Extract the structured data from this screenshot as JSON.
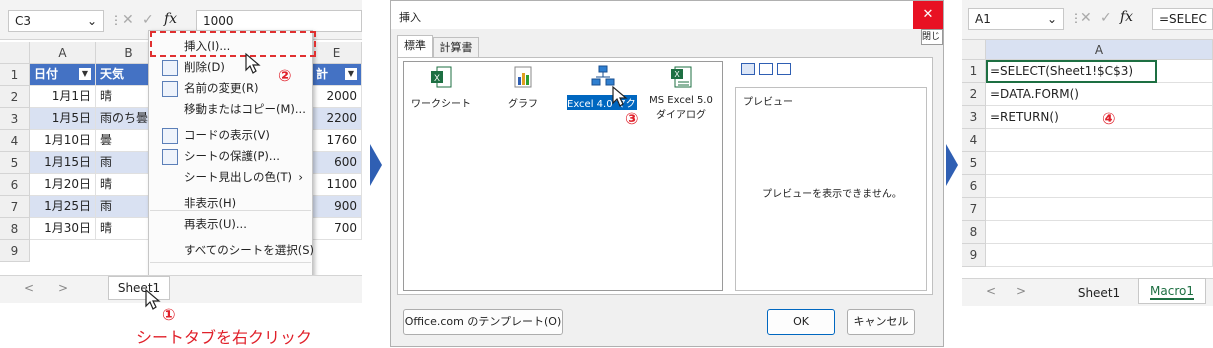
{
  "panel1": {
    "name_box": "C3",
    "formula_value": "1000",
    "columns": [
      "A",
      "B",
      "E"
    ],
    "rows": [
      "1",
      "2",
      "3",
      "4",
      "5",
      "6",
      "7",
      "8",
      "9"
    ],
    "table_header": {
      "date": "日付",
      "weather": "天気",
      "amount": "計"
    },
    "table_rows": [
      {
        "date": "1月1日",
        "weather": "晴",
        "amount": "2000"
      },
      {
        "date": "1月5日",
        "weather": "雨のち曇",
        "amount": "2200"
      },
      {
        "date": "1月10日",
        "weather": "曇",
        "amount": "1760"
      },
      {
        "date": "1月15日",
        "weather": "雨",
        "amount": "600"
      },
      {
        "date": "1月20日",
        "weather": "晴",
        "amount": "1100"
      },
      {
        "date": "1月25日",
        "weather": "雨",
        "amount": "900"
      },
      {
        "date": "1月30日",
        "weather": "晴",
        "amount": "700"
      }
    ],
    "context_menu": [
      {
        "label": "挿入(I)...",
        "icon": "none"
      },
      {
        "label": "削除(D)",
        "icon": "delete-sheet-icon"
      },
      {
        "label": "名前の変更(R)",
        "icon": "rename-icon"
      },
      {
        "label": "移動またはコピー(M)...",
        "icon": "none"
      },
      {
        "label": "コードの表示(V)",
        "icon": "view-code-icon"
      },
      {
        "label": "シートの保護(P)...",
        "icon": "protect-sheet-icon"
      },
      {
        "label": "シート見出しの色(T)",
        "icon": "none",
        "submenu": "›"
      },
      {
        "label": "非表示(H)",
        "icon": "none"
      },
      {
        "label": "再表示(U)...",
        "icon": "none"
      },
      {
        "label": "すべてのシートを選択(S)",
        "icon": "none"
      }
    ],
    "sheet_tab": "Sheet1",
    "step1": "①",
    "step2": "②",
    "caption": "シートタブを右クリック",
    "nav_left": "<",
    "nav_right": ">"
  },
  "panel2": {
    "title": "挿入",
    "close": "✕",
    "side_close": "閉じ",
    "tabs": [
      "標準",
      "計算書"
    ],
    "templates": [
      {
        "label": "ワークシート",
        "icon": "worksheet-icon"
      },
      {
        "label": "グラフ",
        "icon": "chart-icon"
      },
      {
        "label": "Excel 4.0 マクロ",
        "icon": "macro-icon"
      },
      {
        "label": "MS Excel 5.0 ダイアログ",
        "icon": "dialog-icon"
      }
    ],
    "preview_label": "プレビュー",
    "preview_text": "プレビューを表示できません。",
    "step3": "③",
    "btn_templates": "Office.com のテンプレート(O)",
    "btn_ok": "OK",
    "btn_cancel": "キャンセル"
  },
  "panel3": {
    "name_box": "A1",
    "formula_value": "=SELEC",
    "column": "A",
    "rows": [
      "1",
      "2",
      "3",
      "4",
      "5",
      "6",
      "7",
      "8",
      "9"
    ],
    "cells": [
      "=SELECT(Sheet1!$C$3)",
      "=DATA.FORM()",
      "=RETURN()"
    ],
    "step4": "④",
    "tabs": [
      "Sheet1",
      "Macro1"
    ],
    "nav_left": "<",
    "nav_right": ">"
  },
  "colors": {
    "accent_blue": "#4472c4",
    "band": "#d9e1f2",
    "annotation_red": "#e0202a",
    "arrow_blue": "#2f5fb3"
  }
}
